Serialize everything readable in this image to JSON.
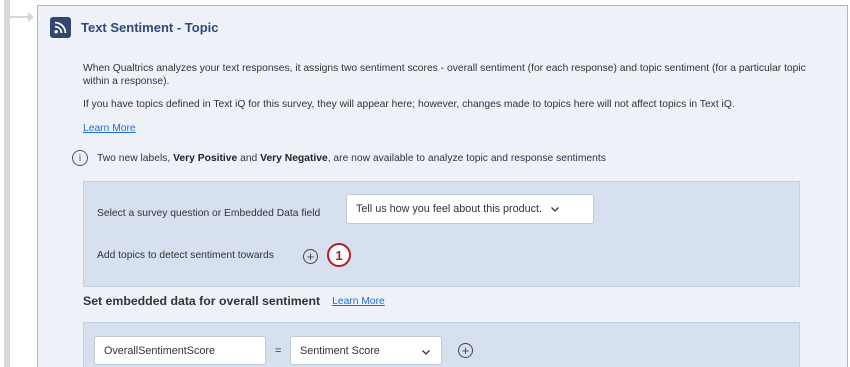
{
  "card": {
    "title": "Text Sentiment - Topic",
    "icon": "rss-icon",
    "accent_color": "#32476e",
    "description_1": "When Qualtrics analyzes your text responses, it assigns two sentiment scores - overall sentiment (for each response) and topic sentiment (for a particular topic within a response).",
    "description_2": "If you have topics defined in Text iQ for this survey, they will appear here; however, changes made to topics here will not affect topics in Text iQ.",
    "learn_more": "Learn More"
  },
  "info": {
    "icon": "info-icon",
    "prefix": "Two new labels, ",
    "label_1": "Very Positive",
    "middle": " and ",
    "label_2": "Very Negative",
    "suffix": ", are now available to analyze topic and response sentiments"
  },
  "panel": {
    "select_label": "Select a survey question or Embedded Data field",
    "select_value": "Tell us how you feel about this product.",
    "topics_label": "Add topics to detect sentiment towards",
    "callout_number": "1",
    "callout_color": "#b31b24"
  },
  "embedded": {
    "title": "Set embedded data for overall sentiment",
    "learn_more": "Learn More",
    "field_value": "OverallSentimentScore",
    "equals": "=",
    "score_value": "Sentiment Score"
  },
  "colors": {
    "link": "#1f6fd1",
    "card_bg": "#eef1f8",
    "panel_bg": "#d7e0ee"
  }
}
